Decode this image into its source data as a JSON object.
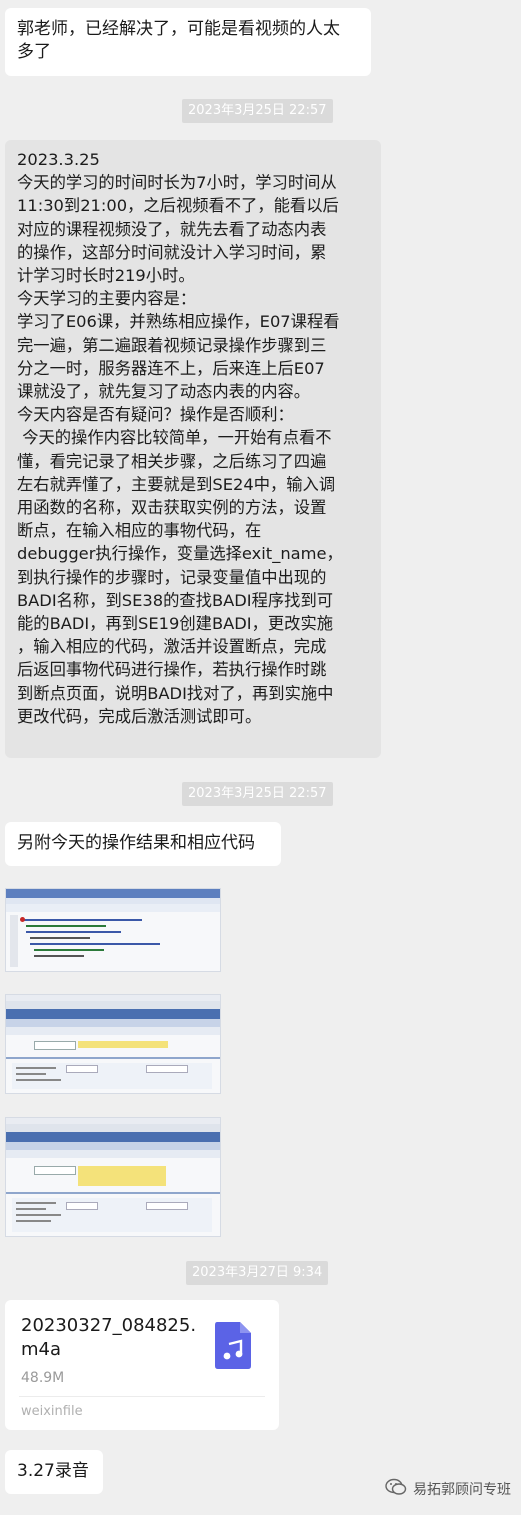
{
  "messages": {
    "m1": "郭老师，已经解决了，可能是看视频的人太\n多了",
    "time1": "2023年3月25日 22:57",
    "report": "2023.3.25\n今天的学习的时间时长为7小时，学习时间从\n11:30到21:00，之后视频看不了，能看以后\n对应的课程视频没了，就先去看了动态内表\n的操作，这部分时间就没计入学习时间，累\n计学习时长时219小时。\n今天学习的主要内容是：\n学习了E06课，并熟练相应操作，E07课程看\n完一遍，第二遍跟着视频记录操作步骤到三\n分之一时，服务器连不上，后来连上后E07\n课就没了，就先复习了动态内表的内容。\n今天内容是否有疑问？操作是否顺利：\n 今天的操作内容比较简单，一开始有点看不\n懂，看完记录了相关步骤，之后练习了四遍\n左右就弄懂了，主要就是到SE24中，输入调\n用函数的名称，双击获取实例的方法，设置\n断点，在输入相应的事物代码，在\ndebugger执行操作，变量选择exit_name，\n到执行操作的步骤时，记录变量值中出现的\nBADI名称，到SE38的查找BADI程序找到可\n能的BADI，再到SE19创建BADI，更改实施\n，输入相应的代码，激活并设置断点，完成\n后返回事物代码进行操作，若执行操作时跳\n到断点页面，说明BADI找对了，再到实施中\n更改代码，完成后激活测试即可。",
    "time2": "2023年3月25日 22:57",
    "m3": "另附今天的操作结果和相应代码",
    "time3": "2023年3月27日 9:34",
    "m5": "3.27录音"
  },
  "file": {
    "name_line1": "20230327_084825.",
    "name_line2": "m4a",
    "size": "48.9M",
    "source": "weixinfile",
    "icon": "music-file-icon",
    "icon_color": "#5b63e6"
  },
  "watermark": {
    "text": "易拓郭顾问专班",
    "icon": "wechat-official-account-icon"
  },
  "colors": {
    "chat_bg": "#efefef",
    "bubble": "#ffffff",
    "highlight_bubble": "#e4e4e4",
    "sap_header": "#4a6fb0"
  }
}
